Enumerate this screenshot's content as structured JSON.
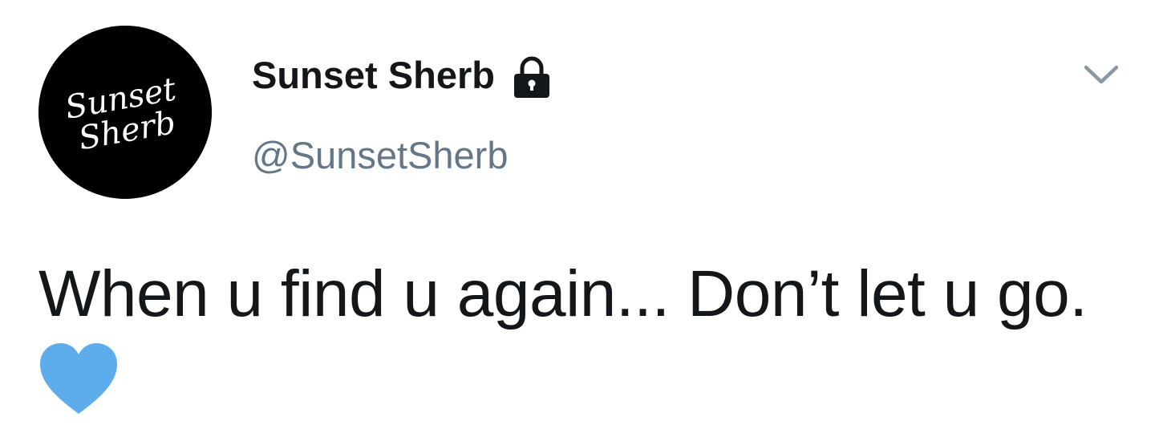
{
  "tweet": {
    "avatar": {
      "logo_text_line1": "Sunset",
      "logo_text_line2": "Sherb",
      "icon": "avatar-logo"
    },
    "display_name": "Sunset Sherb",
    "protected_icon": "lock-icon",
    "handle": "@SunsetSherb",
    "menu_icon": "chevron-down-icon",
    "text": "When u find u again... Don’t let u go.",
    "emoji": "blue-heart-icon"
  },
  "colors": {
    "primary_text": "#14171a",
    "secondary_text": "#657786",
    "caret": "#8899a6",
    "heart": "#5dadec",
    "avatar_bg": "#000000"
  }
}
